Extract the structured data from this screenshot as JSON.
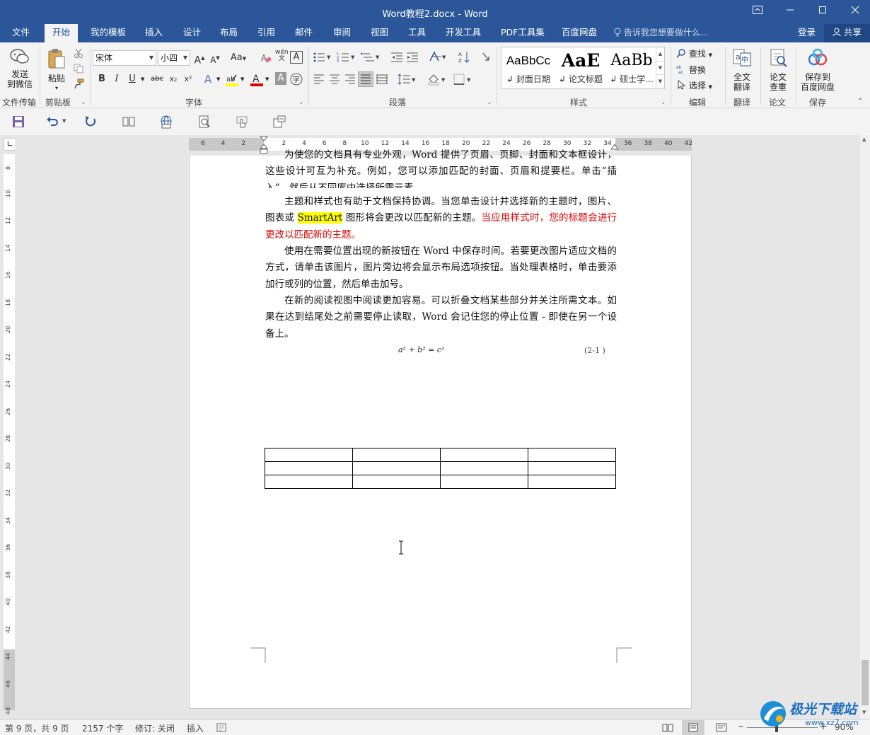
{
  "window": {
    "title": "Word教程2.docx - Word",
    "controls": [
      "restore-ribbon",
      "minimize",
      "maximize",
      "close"
    ]
  },
  "tabs": [
    {
      "label": "文件",
      "active": false
    },
    {
      "label": "开始",
      "active": true
    },
    {
      "label": "我的模板",
      "active": false
    },
    {
      "label": "插入",
      "active": false
    },
    {
      "label": "设计",
      "active": false
    },
    {
      "label": "布局",
      "active": false
    },
    {
      "label": "引用",
      "active": false
    },
    {
      "label": "邮件",
      "active": false
    },
    {
      "label": "审阅",
      "active": false
    },
    {
      "label": "视图",
      "active": false
    },
    {
      "label": "工具",
      "active": false
    },
    {
      "label": "开发工具",
      "active": false
    },
    {
      "label": "PDF工具集",
      "active": false
    },
    {
      "label": "百度网盘",
      "active": false
    }
  ],
  "tell_me": "告诉我您想要做什么...",
  "account": {
    "login": "登录",
    "share": "共享"
  },
  "ribbon": {
    "wechat": {
      "label_line1": "发送",
      "label_line2": "到微信",
      "group": "文件传输"
    },
    "clipboard": {
      "paste": "粘贴",
      "group": "剪贴板"
    },
    "font": {
      "name": "宋体",
      "size": "小四",
      "case_btn": "Aa",
      "group": "字体",
      "bold": "B",
      "italic": "I",
      "underline": "U",
      "strike": "abc",
      "subscript": "x₂",
      "superscript": "x²",
      "pinyin": "wén",
      "font_color": "#e00000",
      "highlight_color": "#ffff00"
    },
    "paragraph": {
      "group": "段落"
    },
    "styles": {
      "group": "样式",
      "items": [
        {
          "preview": "AaBbCc",
          "name": "封面日期"
        },
        {
          "preview": "AaE",
          "name": "论文标题"
        },
        {
          "preview": "AaBb",
          "name": "硕士学..."
        }
      ]
    },
    "editing": {
      "find": "查找",
      "replace": "替换",
      "select": "选择",
      "group": "编辑"
    },
    "translate": {
      "label_line1": "全文",
      "label_line2": "翻译",
      "group": "翻译"
    },
    "paper": {
      "label_line1": "论文",
      "label_line2": "查重",
      "group": "论文"
    },
    "save": {
      "label_line1": "保存到",
      "label_line2": "百度网盘",
      "group": "保存"
    }
  },
  "ruler": {
    "h_ticks": [
      "6",
      "4",
      "2",
      "",
      "2",
      "4",
      "6",
      "8",
      "10",
      "12",
      "14",
      "16",
      "18",
      "20",
      "22",
      "24",
      "26",
      "28",
      "30",
      "32",
      "34",
      "36",
      "38",
      "40",
      "42"
    ],
    "v_ticks": [
      "8",
      "10",
      "12",
      "14",
      "16",
      "18",
      "20",
      "22",
      "24",
      "26",
      "28",
      "30",
      "32",
      "34",
      "36",
      "38",
      "40",
      "42",
      "44",
      "46",
      "48"
    ]
  },
  "document": {
    "para_cut": "为使您的文档具有专业外观，Word 提供了页眉、页脚、封面和文本框设计，这些设计可互为补充。例如，您可以添加匹配的封面、页眉和提要栏。单击“插入”，然后从不同库中选择所需元素。",
    "para2_a": "主题和样式也有助于文档保持协调。当您单击设计并选择新的主题时，图片、图表或",
    "para2_highlight": "SmartArt",
    "para2_b": "图形将会更改以匹配新的主题。",
    "para2_red": "当应用样式时，您的标题会进行更改以匹配新的主题。",
    "para3": "使用在需要位置出现的新按钮在 Word 中保存时间。若要更改图片适应文档的方式，请单击该图片，图片旁边将会显示布局选项按钮。当处理表格时，单击要添加行或列的位置，然后单击加号。",
    "para4": "在新的阅读视图中阅读更加容易。可以折叠文档某些部分并关注所需文本。如果在达到结尾处之前需要停止读取，Word 会记住您的停止位置 - 即使在另一个设备上。",
    "equation": "a² + b² = c²",
    "equation_number": "(2-1 )",
    "table": {
      "rows": 3,
      "cols": 4
    }
  },
  "status": {
    "page": "第 9 页，共 9 页",
    "words": "2157 个字",
    "track": "修订: 关闭",
    "mode": "插入",
    "zoom": "90%"
  },
  "watermark": {
    "text": "极光下载站",
    "url": "www.xz7.com"
  }
}
